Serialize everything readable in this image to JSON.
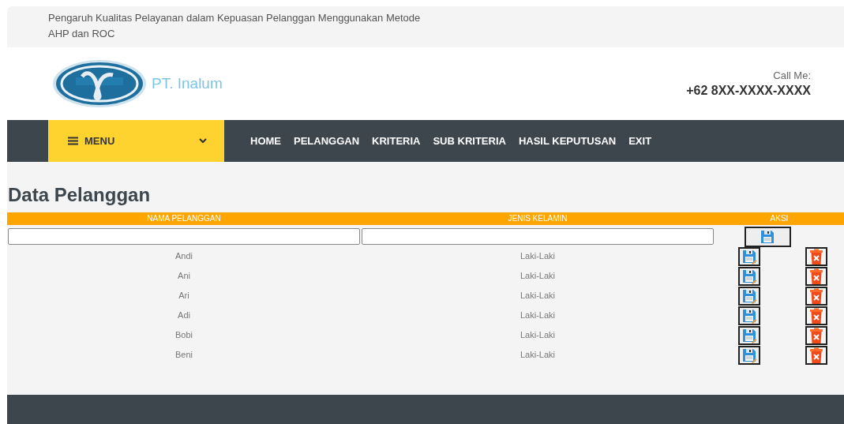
{
  "top_bar": {
    "title": "Pengaruh Kualitas Pelayanan dalam Kepuasan Pelanggan Menggunakan Metode AHP dan ROC"
  },
  "header": {
    "company": "PT. Inalum",
    "call_label": "Call Me:",
    "phone": "+62 8XX-XXXX-XXXX"
  },
  "nav": {
    "menu_label": "MENU",
    "items": [
      "HOME",
      "PELANGGAN",
      "KRITERIA",
      "SUB KRITERIA",
      "HASIL KEPUTUSAN",
      "EXIT"
    ]
  },
  "page": {
    "title": "Data Pelanggan"
  },
  "table": {
    "columns": [
      {
        "label": "NAMA PELANGGAN",
        "kind": "text"
      },
      {
        "label": "JENIS KELAMIN",
        "kind": "text"
      },
      {
        "label": "AKSI",
        "kind": "action"
      }
    ],
    "rows": [
      {
        "name": "Andi",
        "gender": "Laki-Laki"
      },
      {
        "name": "Ani",
        "gender": "Laki-Laki"
      },
      {
        "name": "Ari",
        "gender": "Laki-Laki"
      },
      {
        "name": "Adi",
        "gender": "Laki-Laki"
      },
      {
        "name": "Bobi",
        "gender": "Laki-Laki"
      },
      {
        "name": "Beni",
        "gender": "Laki-Laki"
      }
    ]
  }
}
